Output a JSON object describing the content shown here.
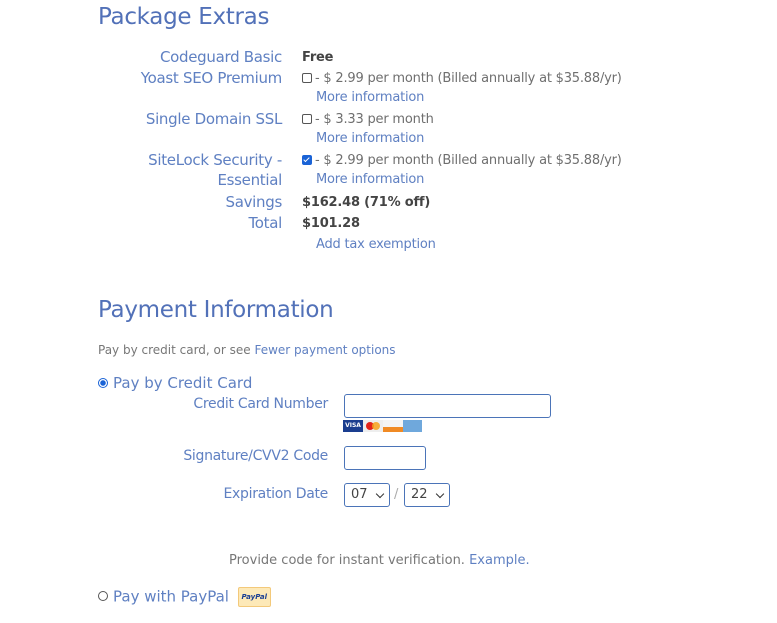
{
  "extras": {
    "heading": "Package Extras",
    "rows": [
      {
        "label": "Codeguard Basic",
        "value": "Free"
      },
      {
        "label": "Yoast SEO Premium",
        "value": "- $ 2.99 per month (Billed annually at $35.88/yr)",
        "checked": false,
        "more": "More information"
      },
      {
        "label": "Single Domain SSL",
        "value": "- $ 3.33 per month",
        "checked": false,
        "more": "More information"
      },
      {
        "label": "SiteLock Security -",
        "label2": "Essential",
        "value": "- $ 2.99 per month (Billed annually at $35.88/yr)",
        "checked": true,
        "more": "More information"
      }
    ],
    "savings_label": "Savings",
    "savings_value": "$162.48 (71% off)",
    "total_label": "Total",
    "total_value": "$101.28",
    "tax_link": "Add tax exemption"
  },
  "payment": {
    "heading": "Payment Information",
    "intro": "Pay by credit card, or see",
    "intro_link": "Fewer payment options",
    "credit_option": "Pay by Credit Card",
    "credit_selected": true,
    "cc_number_label": "Credit Card Number",
    "cc_number_value": "",
    "card_brands": [
      "VISA",
      "MasterCard",
      "Discover",
      "Amex"
    ],
    "cvv_label": "Signature/CVV2 Code",
    "cvv_value": "",
    "exp_label": "Expiration Date",
    "exp_month": "07",
    "exp_sep": "/",
    "exp_year": "22",
    "verify_text": "Provide code for instant verification.",
    "verify_link": "Example.",
    "paypal_option": "Pay with PayPal",
    "paypal_logo": "PayPal"
  }
}
